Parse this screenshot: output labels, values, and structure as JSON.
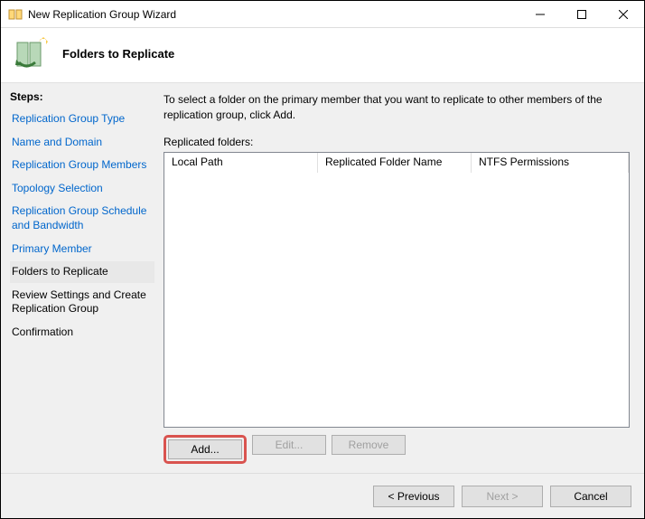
{
  "titlebar": {
    "title": "New Replication Group Wizard"
  },
  "header": {
    "title": "Folders to Replicate"
  },
  "sidebar": {
    "title": "Steps:",
    "steps": [
      {
        "label": "Replication Group Type"
      },
      {
        "label": "Name and Domain"
      },
      {
        "label": "Replication Group Members"
      },
      {
        "label": "Topology Selection"
      },
      {
        "label": "Replication Group Schedule and Bandwidth"
      },
      {
        "label": "Primary Member"
      },
      {
        "label": "Folders to Replicate"
      },
      {
        "label": "Review Settings and Create Replication Group"
      },
      {
        "label": "Confirmation"
      }
    ]
  },
  "main": {
    "instruction": "To select a folder on the primary member that you want to replicate to other members of the replication group, click Add.",
    "list_label": "Replicated folders:",
    "columns": {
      "c1": "Local Path",
      "c2": "Replicated Folder Name",
      "c3": "NTFS Permissions"
    },
    "buttons": {
      "add": "Add...",
      "edit": "Edit...",
      "remove": "Remove"
    }
  },
  "footer": {
    "previous": "< Previous",
    "next": "Next >",
    "cancel": "Cancel"
  }
}
